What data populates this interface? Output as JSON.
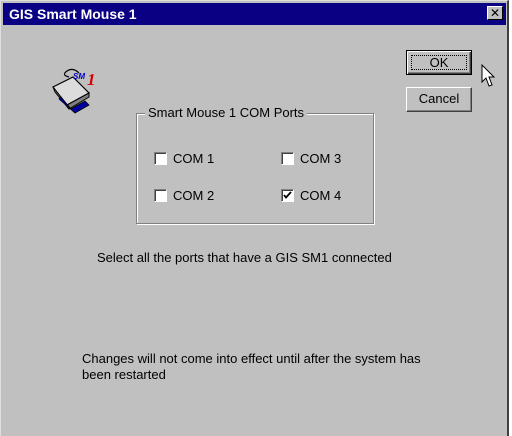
{
  "window": {
    "title": "GIS Smart Mouse 1",
    "close_glyph": "✕"
  },
  "app_icon": {
    "name": "smart-mouse-icon",
    "lettering": "SM1"
  },
  "buttons": {
    "ok_label": "OK",
    "cancel_label": "Cancel"
  },
  "group": {
    "legend": "Smart Mouse 1 COM Ports",
    "ports": [
      {
        "label": "COM 1",
        "checked": false
      },
      {
        "label": "COM 2",
        "checked": false
      },
      {
        "label": "COM 3",
        "checked": false
      },
      {
        "label": "COM 4",
        "checked": true
      }
    ]
  },
  "instructions": "Select all the ports that have a GIS SM1 connected",
  "notice": "Changes will not come into effect until after the system has been restarted",
  "colors": {
    "titlebar": "#0a0083",
    "face": "#c0c0c0",
    "icon_accent": "#d40000"
  }
}
